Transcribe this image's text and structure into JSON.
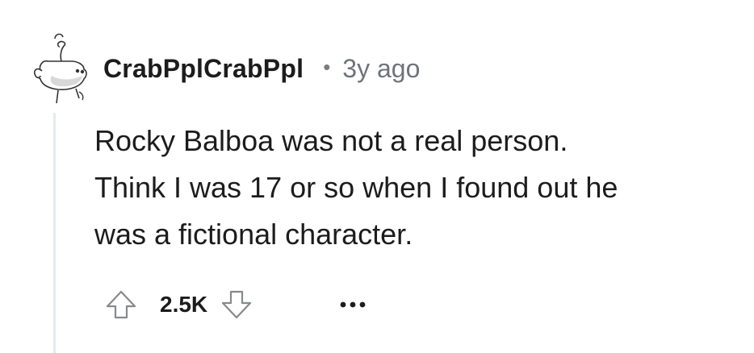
{
  "comment": {
    "author": "CrabPplCrabPpl",
    "separator": "•",
    "age": "3y ago",
    "body_lines": [
      "Rocky Balboa was not a real person.",
      "Think I was 17 or so when I found out he",
      "was a fictional character."
    ],
    "score": "2.5K"
  },
  "icons": {
    "avatar": "snoo-avatar-icon",
    "upvote": "upvote-arrow-icon",
    "downvote": "downvote-arrow-icon",
    "more": "more-options-icon"
  },
  "colors": {
    "text": "#1c1c1c",
    "meta": "#6f7479",
    "icon_stroke": "#878a8c",
    "thread_line": "#e5ebee"
  }
}
